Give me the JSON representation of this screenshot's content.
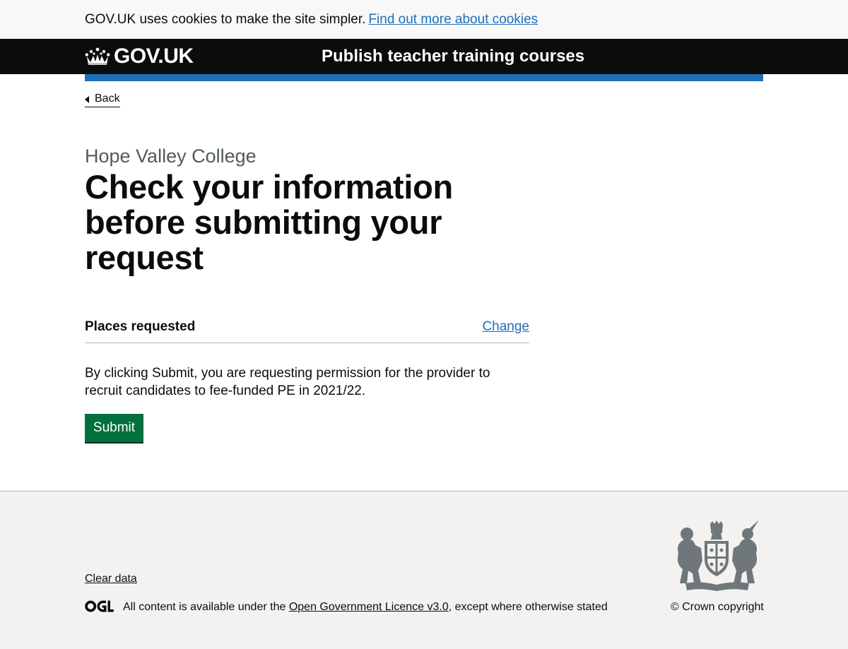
{
  "cookie_banner": {
    "message": "GOV.UK uses cookies to make the site simpler.",
    "link_text": "Find out more about cookies"
  },
  "header": {
    "logo_text": "GOV.UK",
    "logo_icon": "crown-icon",
    "service_name": "Publish teacher training courses"
  },
  "nav": {
    "back_label": "Back"
  },
  "main": {
    "caption": "Hope Valley College",
    "title": "Check your information before submitting your request",
    "summary": {
      "key": "Places requested",
      "change_label": "Change"
    },
    "notice": "By clicking Submit, you are requesting permission for the provider to recruit candidates to fee-funded PE in 2021/22.",
    "submit_label": "Submit"
  },
  "footer": {
    "clear_data_label": "Clear data",
    "ogl_icon": "ogl-logo",
    "licence_prefix": "All content is available under the",
    "licence_link": "Open Government Licence v3.0",
    "licence_suffix": ", except where otherwise stated",
    "copyright": "© Crown copyright",
    "crest_icon": "royal-coat-of-arms-icon"
  },
  "colors": {
    "brand_blue": "#1d70b8",
    "header_black": "#0b0c0c",
    "button_green": "#00703c",
    "caption_grey": "#505a5f",
    "footer_bg": "#f3f2f1"
  }
}
